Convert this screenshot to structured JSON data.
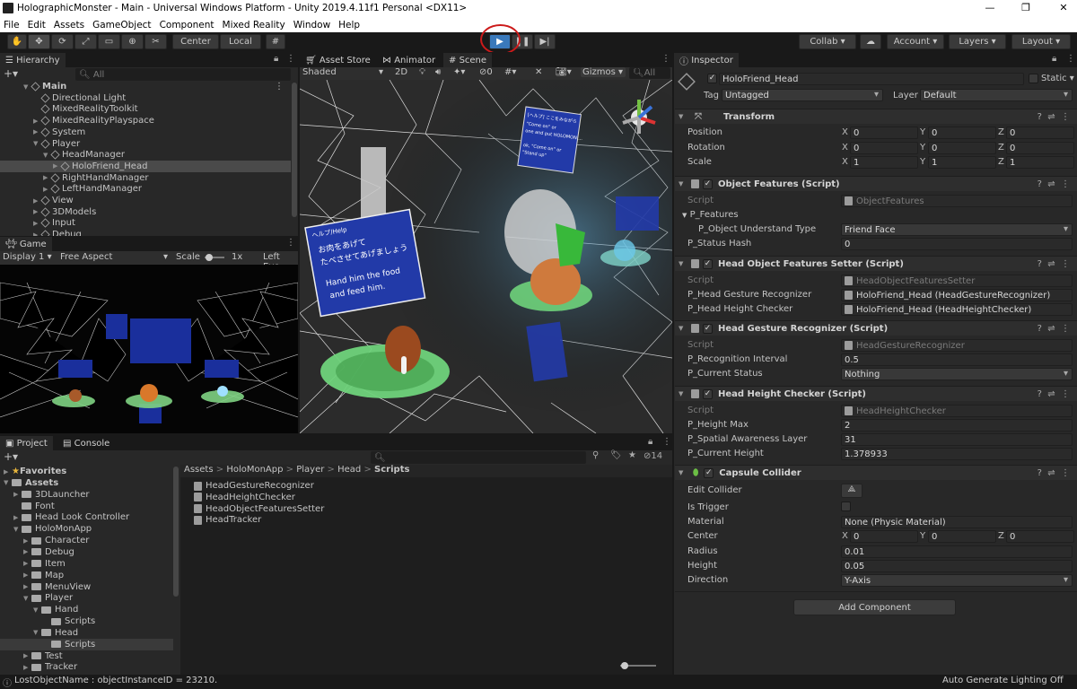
{
  "window": {
    "title": "HolographicMonster - Main - Universal Windows Platform - Unity 2019.4.11f1 Personal <DX11>",
    "minimize": "—",
    "maximize": "❐",
    "close": "✕"
  },
  "menu": [
    "File",
    "Edit",
    "Assets",
    "GameObject",
    "Component",
    "Mixed Reality",
    "Window",
    "Help"
  ],
  "toolbar": {
    "pivot": "Center",
    "space": "Local",
    "collab": "Collab",
    "account": "Account",
    "layers": "Layers",
    "layout": "Layout"
  },
  "hierarchy": {
    "tab": "Hierarchy",
    "search": "All",
    "items": [
      {
        "label": "Main",
        "indent": 0,
        "fold": "▼",
        "bold": true
      },
      {
        "label": "Directional Light",
        "indent": 1,
        "fold": ""
      },
      {
        "label": "MixedRealityToolkit",
        "indent": 1,
        "fold": ""
      },
      {
        "label": "MixedRealityPlayspace",
        "indent": 1,
        "fold": "▶"
      },
      {
        "label": "System",
        "indent": 1,
        "fold": "▶"
      },
      {
        "label": "Player",
        "indent": 1,
        "fold": "▼"
      },
      {
        "label": "HeadManager",
        "indent": 2,
        "fold": "▼"
      },
      {
        "label": "HoloFriend_Head",
        "indent": 3,
        "fold": "▶",
        "selected": true
      },
      {
        "label": "RightHandManager",
        "indent": 2,
        "fold": "▶"
      },
      {
        "label": "LeftHandManager",
        "indent": 2,
        "fold": "▶"
      },
      {
        "label": "View",
        "indent": 1,
        "fold": "▶"
      },
      {
        "label": "3DModels",
        "indent": 1,
        "fold": "▶"
      },
      {
        "label": "Input",
        "indent": 1,
        "fold": "▶"
      },
      {
        "label": "Debug",
        "indent": 1,
        "fold": "▶"
      }
    ]
  },
  "game": {
    "tab": "Game",
    "display": "Display 1",
    "aspect": "Free Aspect",
    "scale_label": "Scale",
    "scale_value": "1x",
    "lefteye": "Left Eye"
  },
  "scene": {
    "tabs": [
      "Asset Store",
      "Animator",
      "Scene"
    ],
    "shading": "Shaded",
    "mode2d": "2D",
    "gizmos": "Gizmos",
    "search": "All",
    "hidden_count": "0",
    "sign1": [
      "へルプ/Help",
      "お肉をあげて",
      "たべさせてあげましょう",
      "Hand him the food",
      "and feed him."
    ],
    "sign2": [
      "[ヘルプ] ここをみながら",
      "\"Come on\" or",
      "one and put HOLOMON ...",
      "ok, \"Come on\" or",
      "\"Stand up\""
    ]
  },
  "project": {
    "tabs": [
      "Project",
      "Console"
    ],
    "breadcrumb": [
      "Assets",
      "HoloMonApp",
      "Player",
      "Head",
      "Scripts"
    ],
    "count": "14",
    "tree": [
      {
        "label": "Favorites",
        "indent": 0,
        "fold": "▶",
        "star": true
      },
      {
        "label": "Assets",
        "indent": 0,
        "fold": "▼",
        "folder": true,
        "bold": true
      },
      {
        "label": "3DLauncher",
        "indent": 1,
        "fold": "▶",
        "folder": true
      },
      {
        "label": "Font",
        "indent": 1,
        "fold": "",
        "folder": true
      },
      {
        "label": "Head Look Controller",
        "indent": 1,
        "fold": "▶",
        "folder": true
      },
      {
        "label": "HoloMonApp",
        "indent": 1,
        "fold": "▼",
        "folder": true
      },
      {
        "label": "Character",
        "indent": 2,
        "fold": "▶",
        "folder": true
      },
      {
        "label": "Debug",
        "indent": 2,
        "fold": "▶",
        "folder": true
      },
      {
        "label": "Item",
        "indent": 2,
        "fold": "▶",
        "folder": true
      },
      {
        "label": "Map",
        "indent": 2,
        "fold": "▶",
        "folder": true
      },
      {
        "label": "MenuView",
        "indent": 2,
        "fold": "▶",
        "folder": true
      },
      {
        "label": "Player",
        "indent": 2,
        "fold": "▼",
        "folder": true
      },
      {
        "label": "Hand",
        "indent": 3,
        "fold": "▼",
        "folder": true
      },
      {
        "label": "Scripts",
        "indent": 4,
        "fold": "",
        "folder": true
      },
      {
        "label": "Head",
        "indent": 3,
        "fold": "▼",
        "folder": true
      },
      {
        "label": "Scripts",
        "indent": 4,
        "fold": "",
        "folder": true,
        "selected": true
      },
      {
        "label": "Test",
        "indent": 2,
        "fold": "▶",
        "folder": true
      },
      {
        "label": "Tracker",
        "indent": 2,
        "fold": "▶",
        "folder": true
      }
    ],
    "files": [
      "HeadGestureRecognizer",
      "HeadHeightChecker",
      "HeadObjectFeaturesSetter",
      "HeadTracker"
    ]
  },
  "inspector": {
    "tab": "Inspector",
    "name": "HoloFriend_Head",
    "static": "Static",
    "tag_label": "Tag",
    "tag": "Untagged",
    "layer_label": "Layer",
    "layer": "Default",
    "transform": {
      "title": "Transform",
      "position_label": "Position",
      "rotation_label": "Rotation",
      "scale_label": "Scale",
      "position": [
        "0",
        "0",
        "0"
      ],
      "rotation": [
        "0",
        "0",
        "0"
      ],
      "scale": [
        "1",
        "1",
        "1"
      ]
    },
    "of": {
      "title": "Object Features (Script)",
      "script_label": "Script",
      "script": "ObjectFeatures",
      "features_label": "P_Features",
      "understand_label": "P_Object Understand Type",
      "understand": "Friend Face",
      "hash_label": "P_Status Hash",
      "hash": "0"
    },
    "hofs": {
      "title": "Head Object Features Setter (Script)",
      "script_label": "Script",
      "script": "HeadObjectFeaturesSetter",
      "gr_label": "P_Head Gesture Recognizer",
      "gr": "HoloFriend_Head (HeadGestureRecognizer)",
      "hc_label": "P_Head Height Checker",
      "hc": "HoloFriend_Head (HeadHeightChecker)"
    },
    "hgr": {
      "title": "Head Gesture Recognizer (Script)",
      "script_label": "Script",
      "script": "HeadGestureRecognizer",
      "ri_label": "P_Recognition Interval",
      "ri": "0.5",
      "cs_label": "P_Current Status",
      "cs": "Nothing"
    },
    "hhc": {
      "title": "Head Height Checker (Script)",
      "script_label": "Script",
      "script": "HeadHeightChecker",
      "hm_label": "P_Height Max",
      "hm": "2",
      "sal_label": "P_Spatial Awareness Layer",
      "sal": "31",
      "ch_label": "P_Current Height",
      "ch": "1.378933"
    },
    "cc": {
      "title": "Capsule Collider",
      "edit_label": "Edit Collider",
      "trigger_label": "Is Trigger",
      "material_label": "Material",
      "material": "None (Physic Material)",
      "center_label": "Center",
      "center": [
        "0",
        "0",
        "0"
      ],
      "radius_label": "Radius",
      "radius": "0.01",
      "height_label": "Height",
      "height": "0.05",
      "direction_label": "Direction",
      "direction": "Y-Axis"
    },
    "add_component": "Add Component"
  },
  "status": {
    "left": "LostObjectName : objectInstanceID = 23210.",
    "right": "Auto Generate Lighting Off"
  },
  "colors": {
    "play_active": "#3a79bb",
    "highlight_ring": "#cc1a1a",
    "selected_row": "#2c5d87"
  }
}
